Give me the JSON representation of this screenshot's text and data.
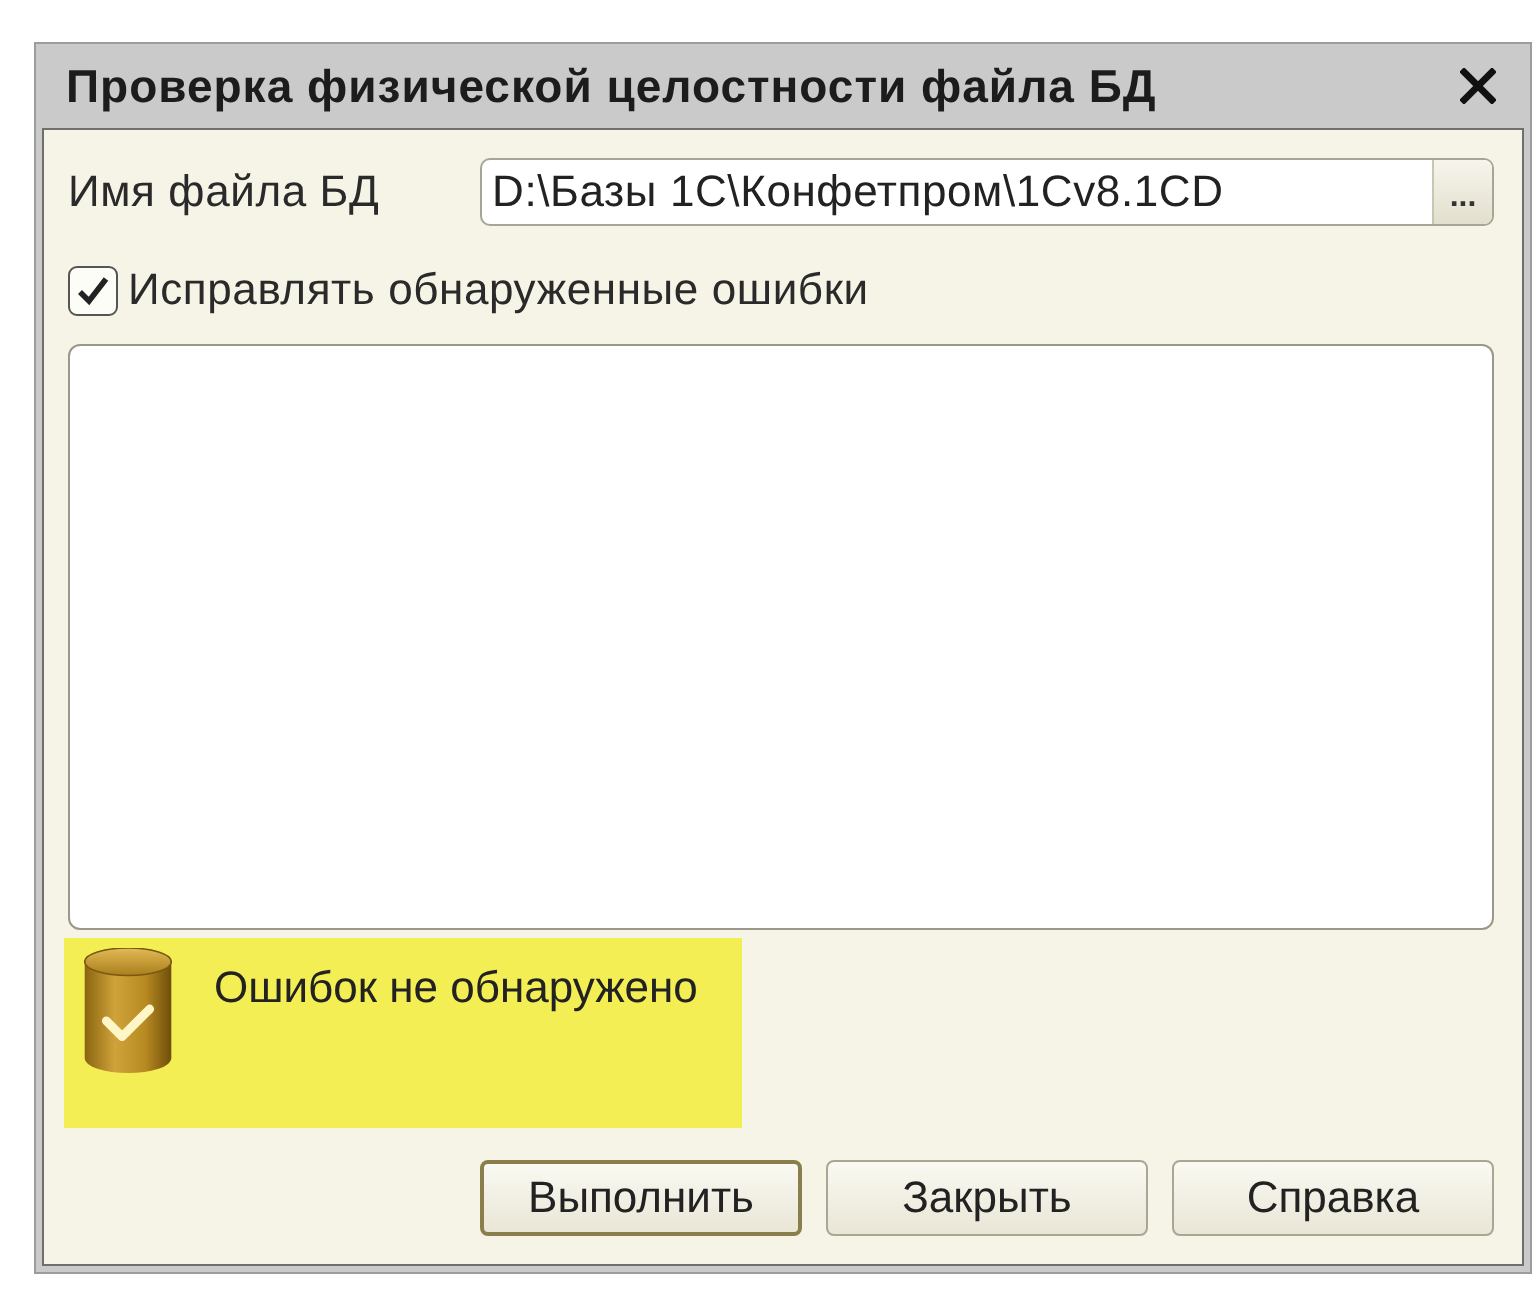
{
  "window": {
    "title": "Проверка физической целостности файла БД"
  },
  "file_field": {
    "label": "Имя файла БД",
    "value": "D:\\Базы 1С\\Конфетпром\\1Cv8.1CD",
    "browse": "..."
  },
  "fix_errors": {
    "label": "Исправлять обнаруженные ошибки",
    "checked": true
  },
  "status": {
    "text": "Ошибок не обнаружено",
    "highlighted": true
  },
  "buttons": [
    {
      "label": "Выполнить",
      "default": true
    },
    {
      "label": "Закрыть",
      "default": false
    },
    {
      "label": "Справка",
      "default": false
    }
  ]
}
